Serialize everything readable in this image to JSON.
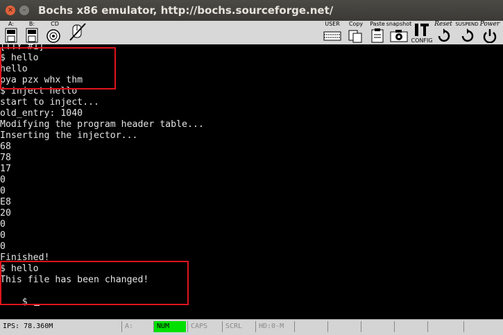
{
  "window": {
    "title": "Bochs x86 emulator, http://bochs.sourceforge.net/",
    "close_glyph": "×",
    "minimize_glyph": "–"
  },
  "toolbar": {
    "floppy_a": "A:",
    "floppy_b": "B:",
    "cdrom": "CD",
    "user": "USER",
    "copy": "Copy",
    "paste": "Paste",
    "snapshot": "snapshot",
    "config": "CONFIG",
    "reset": "Reset",
    "suspend": "SUSPEND",
    "power": "Power"
  },
  "terminal": {
    "lines": [
      "[TTY #1]",
      "$ hello",
      "hello",
      "pya pzx whx thm",
      "$ inject hello",
      "start to inject...",
      "old_entry: 1040",
      "Modifying the program header table...",
      "Inserting the injector...",
      "68",
      "78",
      "17",
      "0",
      "0",
      "E8",
      "20",
      "0",
      "0",
      "0",
      "Finished!",
      "$ hello",
      "This file has been changed!",
      "$ "
    ]
  },
  "statusbar": {
    "ips": "IPS: 78.360M",
    "drive": "A:",
    "num": "NUM",
    "caps": "CAPS",
    "scrl": "SCRL",
    "hd": "HD:0-M"
  },
  "colors": {
    "highlight_box": "#e0141c",
    "num_active": "#00e000",
    "terminal_text": "#e4e4e4"
  }
}
